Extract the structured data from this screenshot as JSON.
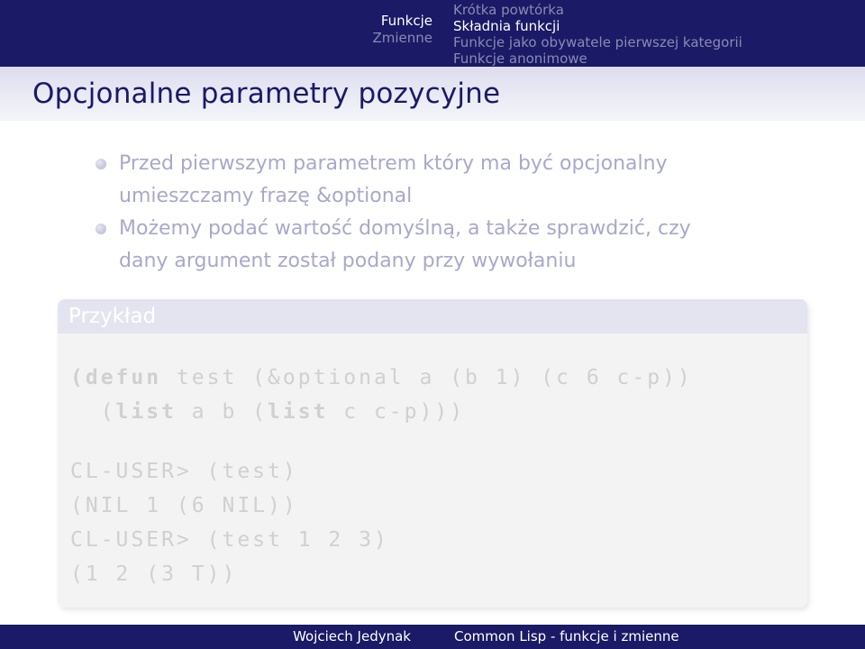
{
  "nav": {
    "sections": [
      "Funkcje",
      "Zmienne"
    ],
    "subsections": [
      "Krótka powtórka",
      "Składnia funkcji",
      "Funkcje jako obywatele pierwszej kategorii",
      "Funkcje anonimowe"
    ]
  },
  "frame": {
    "title": "Opcjonalne parametry pozycyjne"
  },
  "bullets": [
    {
      "line1": "Przed pierwszym parametrem który ma być opcjonalny",
      "line2": "umieszczamy frazę &optional"
    },
    {
      "line1": "Możemy podać wartość domyślną, a także sprawdzić, czy",
      "line2": "dany argument został podany przy wywołaniu"
    }
  ],
  "example": {
    "title": "Przykład",
    "code": [
      {
        "kw": "(defun",
        "rest": " test (&optional a (b 1) (c 6 c-p))"
      },
      {
        "pre": "  (",
        "kw": "list",
        "mid": " a b (",
        "kw2": "list",
        "rest": " c c-p)))"
      }
    ],
    "output": [
      "CL-USER> (test)",
      "(NIL 1 (6 NIL))",
      "CL-USER> (test 1 2 3)",
      "(1 2 (3 T))"
    ]
  },
  "footer": {
    "author": "Wojciech Jedynak",
    "talk_title": "Common Lisp - funkcje i zmienne"
  },
  "colors": {
    "header_bg": "#1a1a66",
    "title_text": "#1a1a66",
    "bullet_text": "#a8a8cc",
    "code_text": "#d0d0d0"
  }
}
